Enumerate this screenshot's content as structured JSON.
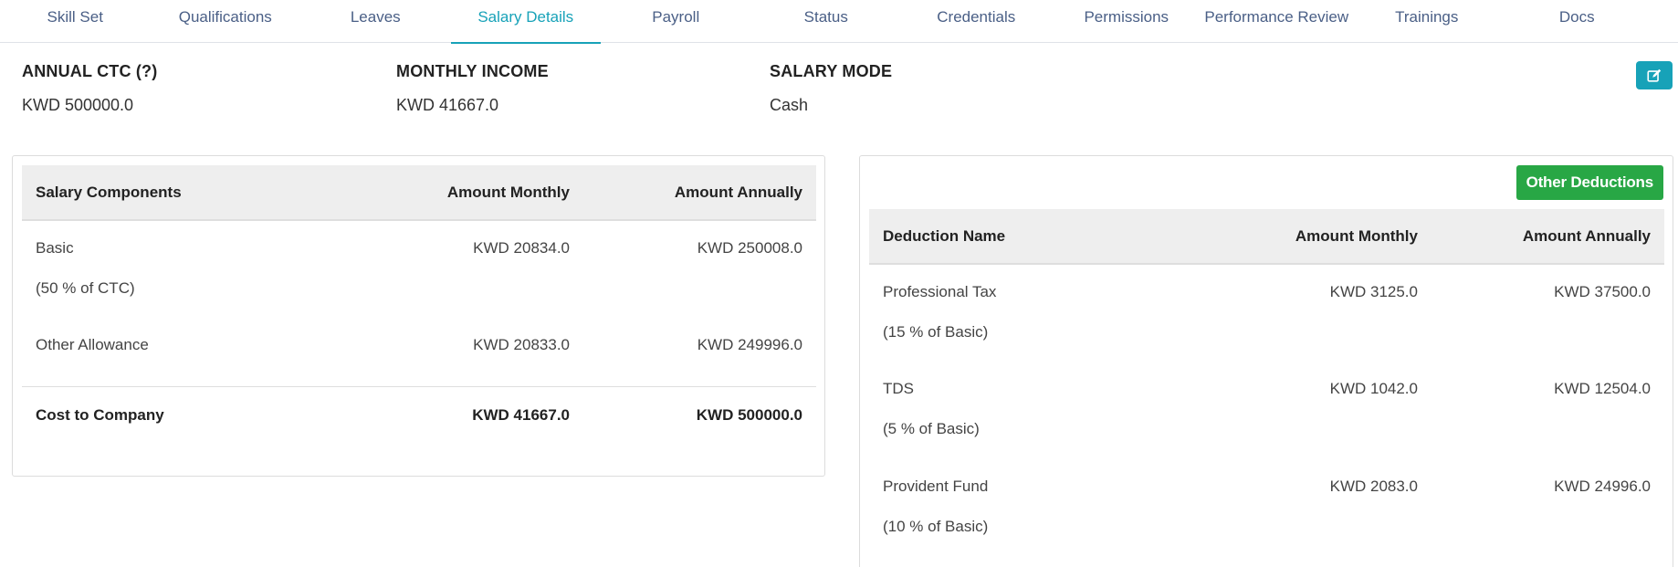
{
  "tabs": [
    {
      "label": "Skill Set",
      "active": false
    },
    {
      "label": "Qualifications",
      "active": false
    },
    {
      "label": "Leaves",
      "active": false
    },
    {
      "label": "Salary Details",
      "active": true
    },
    {
      "label": "Payroll",
      "active": false
    },
    {
      "label": "Status",
      "active": false
    },
    {
      "label": "Credentials",
      "active": false
    },
    {
      "label": "Permissions",
      "active": false
    },
    {
      "label": "Performance Review",
      "active": false
    },
    {
      "label": "Trainings",
      "active": false
    },
    {
      "label": "Docs",
      "active": false
    }
  ],
  "summary": {
    "annual_ctc_label": "ANNUAL CTC (?)",
    "annual_ctc_value": "KWD 500000.0",
    "monthly_income_label": "MONTHLY INCOME",
    "monthly_income_value": "KWD 41667.0",
    "salary_mode_label": "SALARY MODE",
    "salary_mode_value": "Cash"
  },
  "edit_icon": "edit-icon",
  "components_table": {
    "headers": [
      "Salary Components",
      "Amount Monthly",
      "Amount Annually"
    ],
    "rows": [
      {
        "name": "Basic",
        "sub": "(50 % of CTC)",
        "monthly": "KWD 20834.0",
        "annually": "KWD 250008.0"
      },
      {
        "name": "Other Allowance",
        "sub": "",
        "monthly": "KWD 20833.0",
        "annually": "KWD 249996.0"
      }
    ],
    "total": {
      "name": "Cost to Company",
      "monthly": "KWD 41667.0",
      "annually": "KWD 500000.0"
    }
  },
  "deductions": {
    "button_label": "Other Deductions",
    "headers": [
      "Deduction Name",
      "Amount Monthly",
      "Amount Annually"
    ],
    "rows": [
      {
        "name": "Professional Tax",
        "sub": "(15 % of Basic)",
        "monthly": "KWD 3125.0",
        "annually": "KWD 37500.0"
      },
      {
        "name": "TDS",
        "sub": "(5 % of Basic)",
        "monthly": "KWD 1042.0",
        "annually": "KWD 12504.0"
      },
      {
        "name": "Provident Fund",
        "sub": "(10 % of Basic)",
        "monthly": "KWD 2083.0",
        "annually": "KWD 24996.0"
      }
    ]
  },
  "colors": {
    "accent": "#17a2b8",
    "success": "#28a745",
    "tab_text": "#4a5f86"
  }
}
